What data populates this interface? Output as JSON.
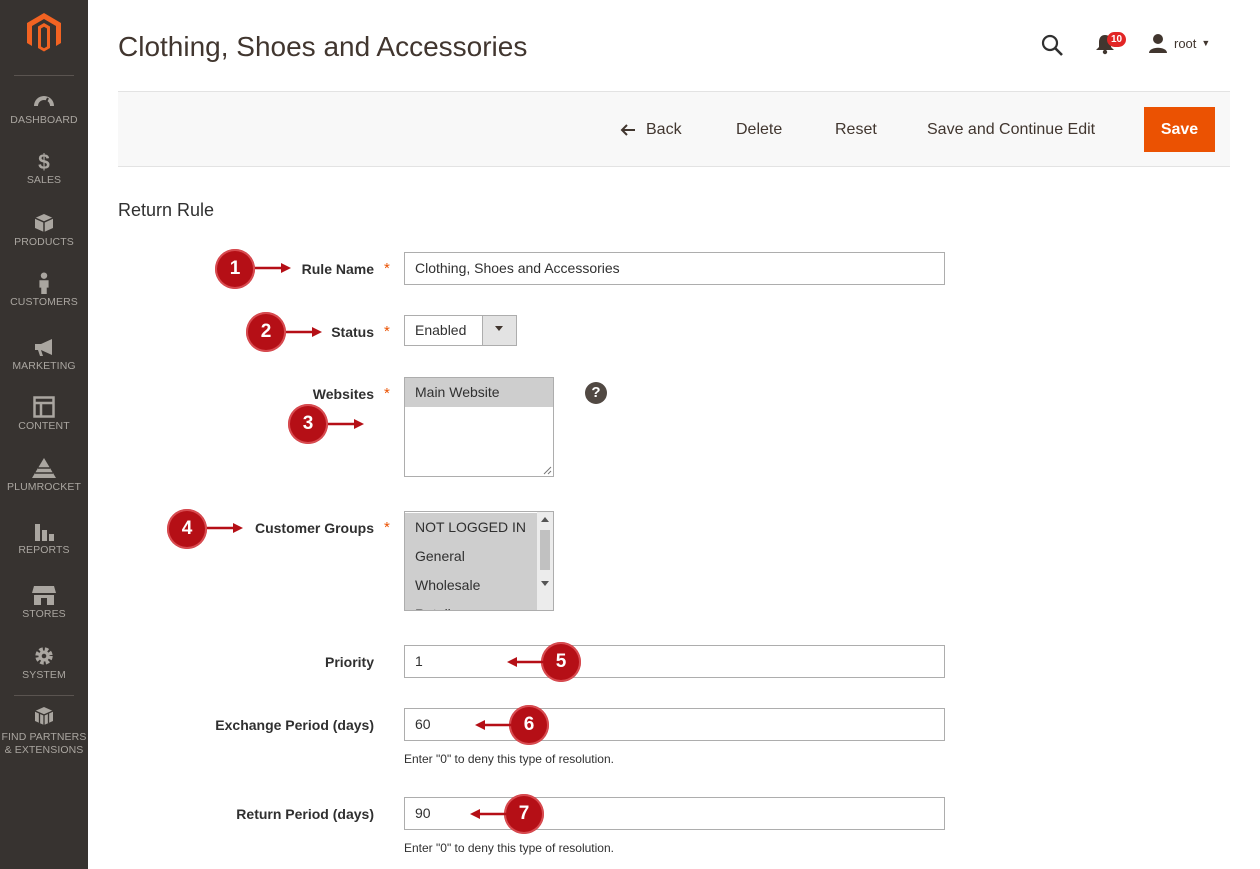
{
  "page": {
    "title": "Clothing, Shoes and Accessories"
  },
  "header": {
    "notifications_count": "10",
    "user_name": "root"
  },
  "sidebar": {
    "items": [
      {
        "label": "DASHBOARD",
        "icon": "dashboard-icon"
      },
      {
        "label": "SALES",
        "icon": "dollar-icon"
      },
      {
        "label": "PRODUCTS",
        "icon": "box-icon"
      },
      {
        "label": "CUSTOMERS",
        "icon": "person-icon"
      },
      {
        "label": "MARKETING",
        "icon": "megaphone-icon"
      },
      {
        "label": "CONTENT",
        "icon": "layout-icon"
      },
      {
        "label": "PLUMROCKET",
        "icon": "pyramid-icon"
      },
      {
        "label": "REPORTS",
        "icon": "bar-chart-icon"
      },
      {
        "label": "STORES",
        "icon": "storefront-icon"
      },
      {
        "label": "SYSTEM",
        "icon": "gear-icon"
      },
      {
        "label_line1": "FIND PARTNERS",
        "label_line2": "& EXTENSIONS",
        "icon": "cubes-icon"
      }
    ]
  },
  "actions": {
    "back": "Back",
    "delete": "Delete",
    "reset": "Reset",
    "save_continue": "Save and Continue Edit",
    "save": "Save"
  },
  "section": {
    "title": "Return Rule"
  },
  "form": {
    "rule_name": {
      "label": "Rule Name",
      "value": "Clothing, Shoes and Accessories"
    },
    "status": {
      "label": "Status",
      "value": "Enabled"
    },
    "websites": {
      "label": "Websites",
      "options": [
        "Main Website"
      ]
    },
    "customer_groups": {
      "label": "Customer Groups",
      "options": [
        "NOT LOGGED IN",
        "General",
        "Wholesale",
        "Retailer"
      ]
    },
    "priority": {
      "label": "Priority",
      "value": "1"
    },
    "exchange_period": {
      "label": "Exchange Period (days)",
      "value": "60",
      "note": "Enter \"0\" to deny this type of resolution."
    },
    "return_period": {
      "label": "Return Period (days)",
      "value": "90",
      "note": "Enter \"0\" to deny this type of resolution."
    },
    "required_mark": "*",
    "help_mark": "?"
  },
  "markers": [
    "1",
    "2",
    "3",
    "4",
    "5",
    "6",
    "7"
  ],
  "colors": {
    "sidebar": "#373330",
    "accent": "#eb5202",
    "marker": "#b50f16"
  }
}
